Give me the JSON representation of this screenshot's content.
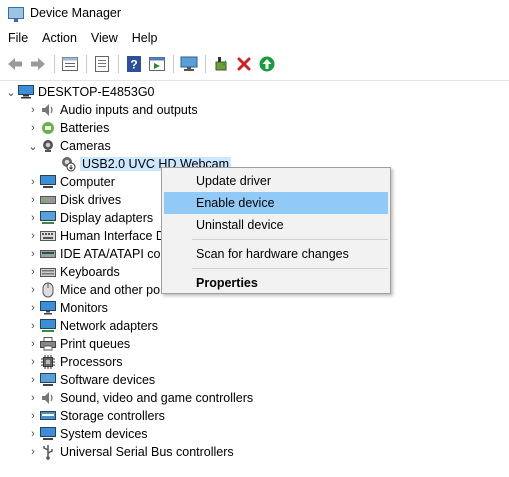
{
  "window": {
    "title": "Device Manager"
  },
  "menu": [
    "File",
    "Action",
    "View",
    "Help"
  ],
  "toolbar": {
    "buttons": [
      "back-icon",
      "forward-icon",
      "properties-icon",
      "list-icon",
      "help-icon",
      "action-icon",
      "monitor-icon",
      "update-driver-icon",
      "uninstall-icon",
      "enable-icon"
    ]
  },
  "tree": {
    "root": "DESKTOP-E4853G0",
    "categories": [
      "Audio inputs and outputs",
      "Batteries",
      "Cameras",
      "USB2.0 UVC HD Webcam",
      "Computer",
      "Disk drives",
      "Display adapters",
      "Human Interface D",
      "IDE ATA/ATAPI cor",
      "Keyboards",
      "Mice and other po",
      "Monitors",
      "Network adapters",
      "Print queues",
      "Processors",
      "Software devices",
      "Sound, video and game controllers",
      "Storage controllers",
      "System devices",
      "Universal Serial Bus controllers"
    ]
  },
  "context_menu": {
    "update_driver": "Update driver",
    "enable_device": "Enable device",
    "uninstall_device": "Uninstall device",
    "scan": "Scan for hardware changes",
    "properties": "Properties"
  },
  "colors": {
    "selection": "#cce8ff",
    "menu_highlight": "#91c9f7"
  }
}
